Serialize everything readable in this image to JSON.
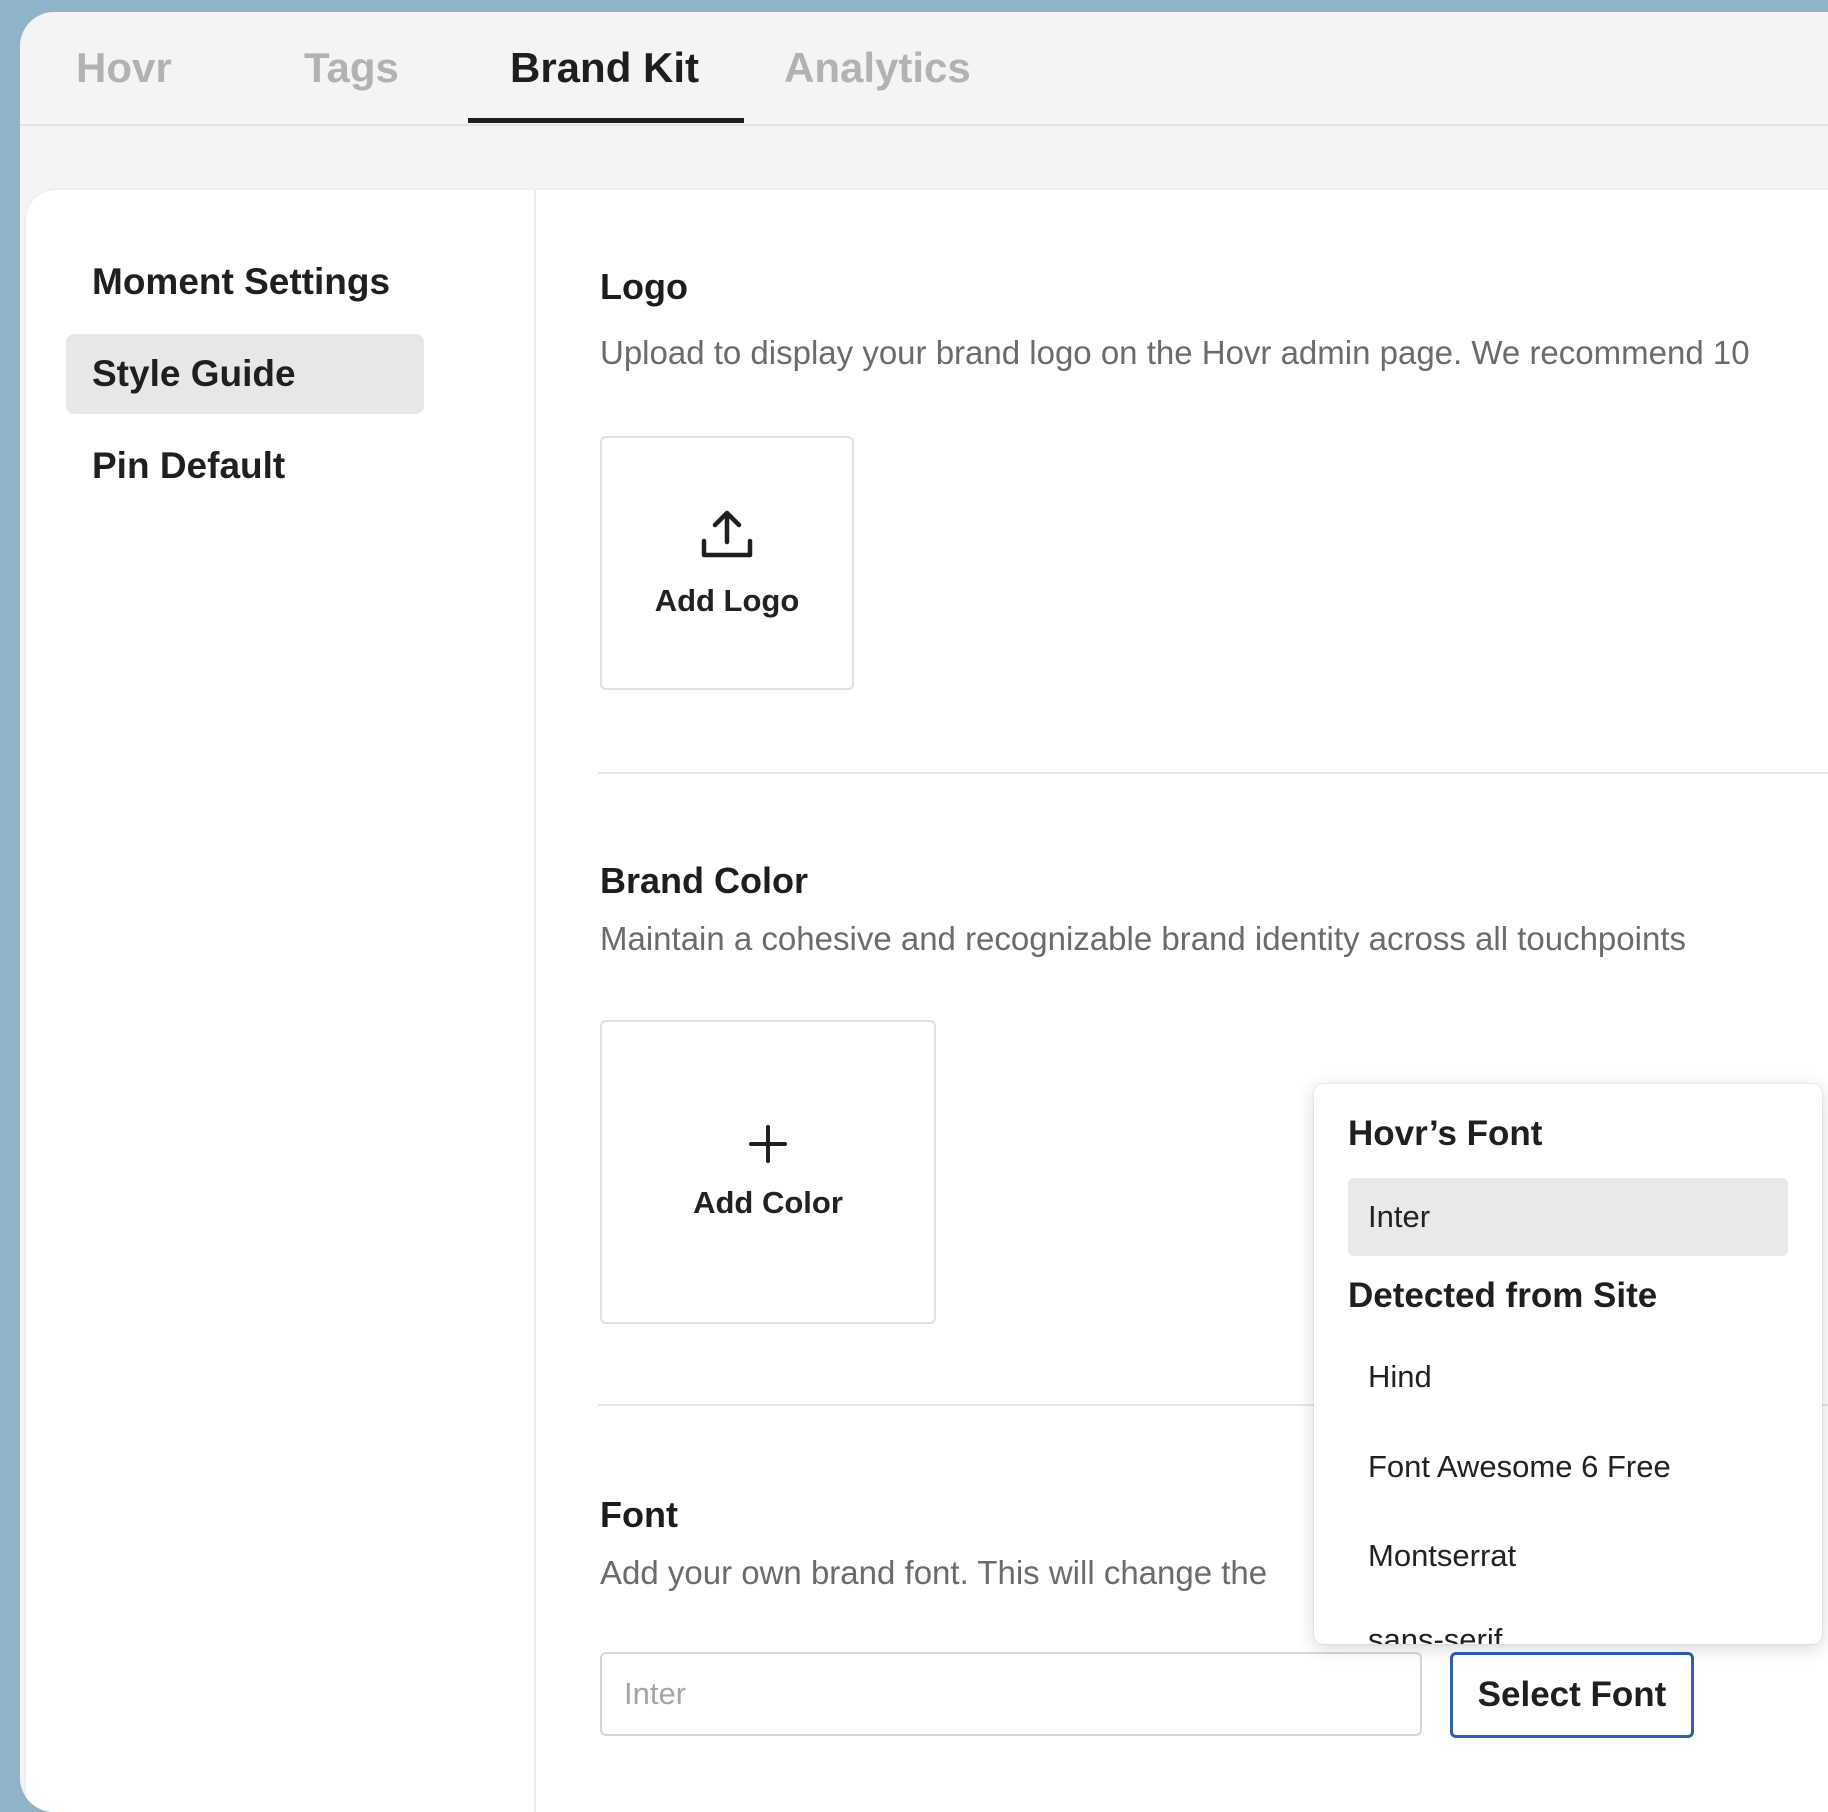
{
  "tabs": [
    {
      "label": "Hovr"
    },
    {
      "label": "Tags"
    },
    {
      "label": "Brand Kit",
      "active": true
    },
    {
      "label": "Analytics"
    }
  ],
  "sidebar": {
    "items": [
      {
        "label": "Moment Settings"
      },
      {
        "label": "Style Guide",
        "active": true
      },
      {
        "label": "Pin Default"
      }
    ]
  },
  "logo": {
    "title": "Logo",
    "description": "Upload to display your brand logo on the Hovr admin page. We recommend 10",
    "add_label": "Add Logo",
    "icon": "upload-icon"
  },
  "brand_color": {
    "title": "Brand Color",
    "description": "Maintain a cohesive and recognizable brand identity across all touchpoints",
    "add_label": "Add Color",
    "icon": "plus-icon"
  },
  "font": {
    "title": "Font",
    "description": "Add your own brand font. This will change the",
    "input_placeholder": "Inter",
    "select_label": "Select Font",
    "accent_color": "#2f5fb3"
  },
  "font_dropdown": {
    "groups": [
      {
        "label": "Hovr’s Font",
        "options": [
          {
            "label": "Inter",
            "selected": true
          }
        ]
      },
      {
        "label": "Detected from Site",
        "options": [
          {
            "label": "Hind"
          },
          {
            "label": "Font Awesome 6 Free"
          },
          {
            "label": "Montserrat"
          },
          {
            "label": "sans-serif"
          }
        ]
      }
    ]
  }
}
